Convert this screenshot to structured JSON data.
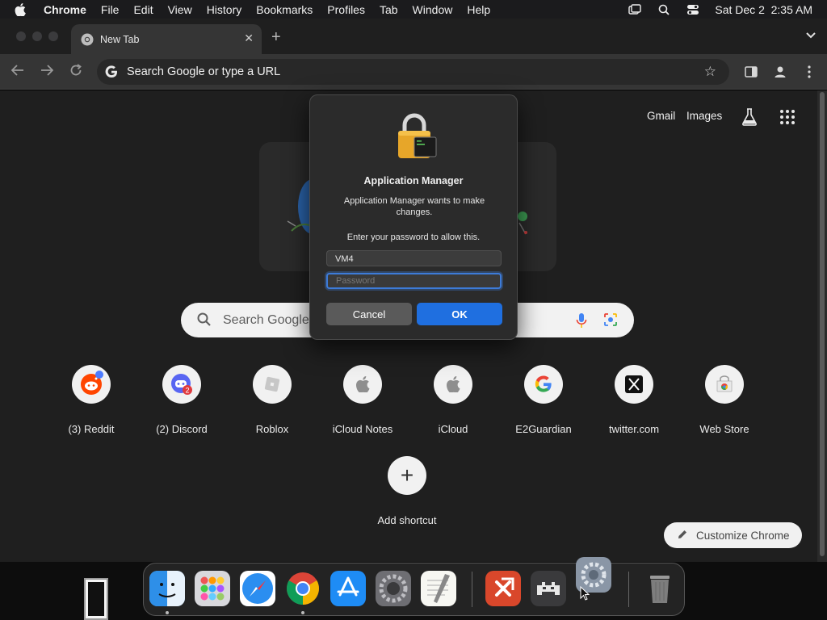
{
  "menubar": {
    "app": "Chrome",
    "items": [
      "File",
      "Edit",
      "View",
      "History",
      "Bookmarks",
      "Profiles",
      "Tab",
      "Window",
      "Help"
    ],
    "clock": "Sat Dec 2  2:35 AM"
  },
  "tab": {
    "title": "New Tab"
  },
  "omnibox": {
    "placeholder": "Search Google or type a URL"
  },
  "ntp": {
    "links": {
      "gmail": "Gmail",
      "images": "Images"
    },
    "search_placeholder": "Search Google",
    "shortcuts": [
      {
        "label": "(3) Reddit",
        "icon": "reddit-icon"
      },
      {
        "label": "(2) Discord",
        "icon": "discord-icon"
      },
      {
        "label": "Roblox",
        "icon": "roblox-icon"
      },
      {
        "label": "iCloud Notes",
        "icon": "apple-icon"
      },
      {
        "label": "iCloud",
        "icon": "apple-icon"
      },
      {
        "label": "E2Guardian",
        "icon": "google-icon"
      },
      {
        "label": "twitter.com",
        "icon": "x-icon"
      },
      {
        "label": "Web Store",
        "icon": "chrome-web-store-icon"
      }
    ],
    "add_shortcut": "Add shortcut",
    "customize": "Customize Chrome"
  },
  "dialog": {
    "title": "Application Manager",
    "message": "Application Manager wants to make changes.",
    "prompt": "Enter your password to allow this.",
    "username_value": "VM4",
    "password_placeholder": "Password",
    "cancel": "Cancel",
    "ok": "OK"
  },
  "dock": {
    "apps": [
      "Finder",
      "Launchpad",
      "Safari",
      "Google Chrome",
      "App Store",
      "System Settings",
      "TextEdit",
      "Remote Desktop",
      "Game Emulator",
      "Trash"
    ]
  },
  "colors": {
    "accent": "#1f6fe0",
    "focus_ring": "#3d7bd8",
    "page_bg": "#1f1f1f"
  }
}
